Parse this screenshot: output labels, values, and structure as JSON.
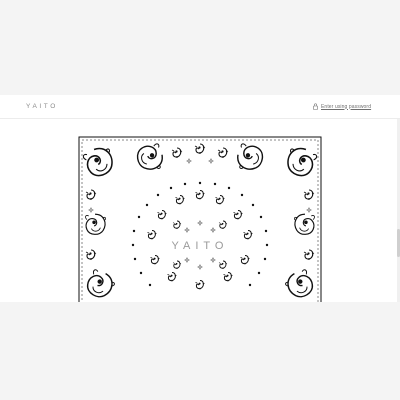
{
  "header": {
    "logo_text": "YAITO",
    "password_link": "Enter using password",
    "lock_icon": "lock-icon"
  },
  "hero": {
    "image": "paisley-bandana-artwork",
    "center_text": "YAITO"
  },
  "colors": {
    "page_background": "#f4f4f4",
    "site_background": "#ffffff",
    "ink": "#111111",
    "logo_gray": "#8a8a8a"
  }
}
